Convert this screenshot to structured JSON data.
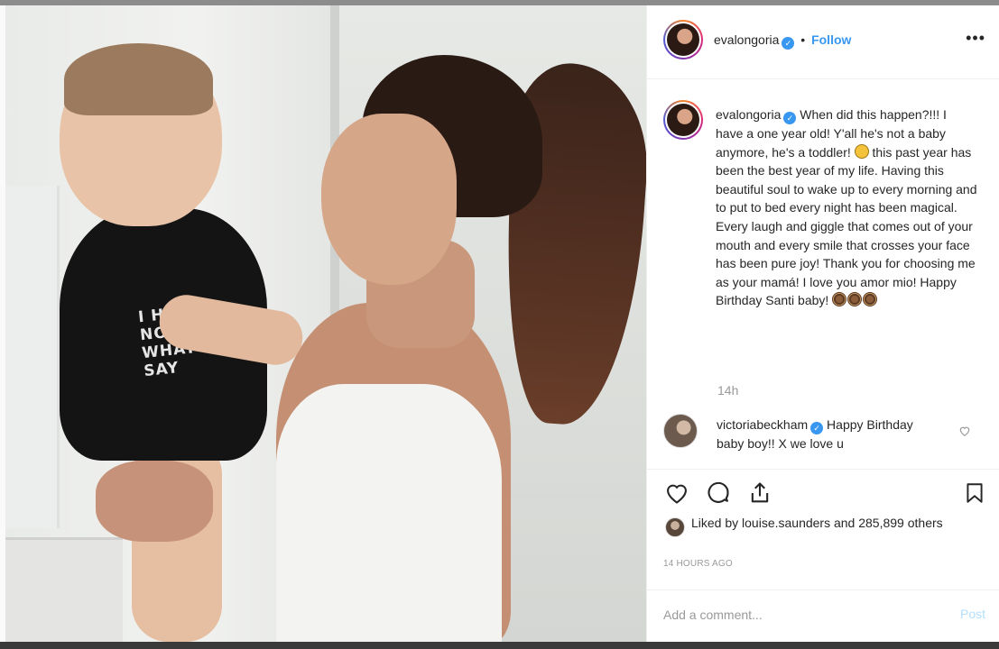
{
  "post": {
    "image_text": "I HAV\nNO\nWHAT\nSAY"
  },
  "header": {
    "username": "evalongoria",
    "separator": "•",
    "follow_label": "Follow",
    "more_label": "•••"
  },
  "caption": {
    "username": "evalongoria",
    "text_part1": "When did this happen?!!! I have a one year old! Y'all he's not a baby anymore, he's a toddler!",
    "text_part2": "this past year has been the best year of my life. Having this beautiful soul to wake up to every morning and to put to bed every night has been magical. Every laugh and giggle that comes out of your mouth and every smile that crosses your face has been pure joy! Thank you for choosing me as your mamá! I love you amor mio! Happy Birthday Santi baby!",
    "time": "14h"
  },
  "reply": {
    "username": "victoriabeckham",
    "text": "Happy Birthday baby boy!! X we love u"
  },
  "likes": {
    "text": "Liked by louise.saunders and 285,899 others"
  },
  "timestamp": "14 HOURS AGO",
  "comment_box": {
    "placeholder": "Add a comment...",
    "post_label": "Post"
  },
  "icons": [
    "heart-icon",
    "comment-icon",
    "share-icon",
    "bookmark-icon",
    "verified-icon",
    "more-icon",
    "laughing-emoji-icon",
    "cake-emoji-icon"
  ],
  "colors": {
    "follow": "#3897f0",
    "verified": "#3897f0",
    "post_disabled": "#b2dffc",
    "muted_text": "#999999"
  }
}
